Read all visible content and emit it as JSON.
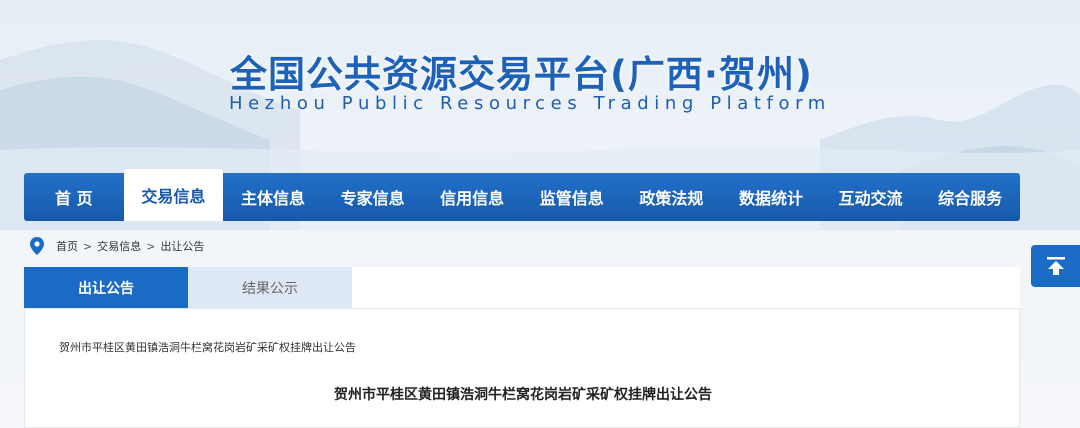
{
  "banner": {
    "title": "全国公共资源交易平台(广西·贺州)",
    "subtitle": "Hezhou Public Resources Trading Platform"
  },
  "nav": {
    "items": [
      "首 页",
      "交易信息",
      "主体信息",
      "专家信息",
      "信用信息",
      "监管信息",
      "政策法规",
      "数据统计",
      "互动交流",
      "综合服务"
    ],
    "active": "交易信息"
  },
  "breadcrumb": {
    "home": "首页",
    "section": "交易信息",
    "current": "出让公告",
    "separator": ">"
  },
  "tabs": {
    "active": "出让公告",
    "inactive": "结果公示"
  },
  "content": {
    "item_link": "贺州市平桂区黄田镇浩洞牛栏窝花岗岩矿采矿权挂牌出让公告",
    "notice_title": "贺州市平桂区黄田镇浩洞牛栏窝花岗岩矿采矿权挂牌出让公告"
  },
  "icons": {
    "location": "location-pin-icon",
    "back_to_top": "back-to-top-icon"
  },
  "colors": {
    "primary": "#1a6bc4",
    "nav_dark": "#1659ab",
    "title_blue": "#1d62b8",
    "tab_inactive": "#dde8f4"
  }
}
